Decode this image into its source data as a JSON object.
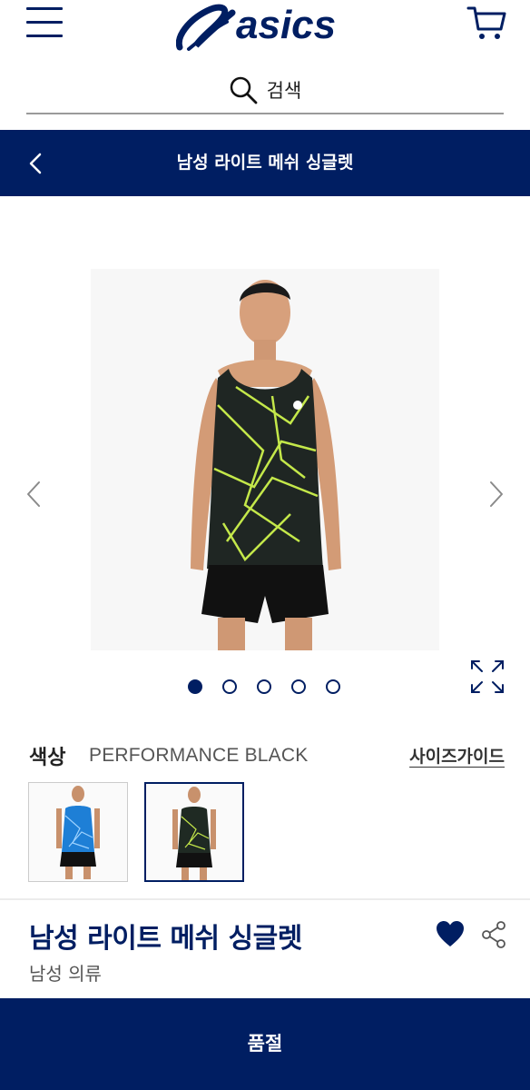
{
  "header": {
    "brand": "asics",
    "search_placeholder": "검색"
  },
  "titlebar": {
    "title": "남성 라이트 메쉬 싱글렛"
  },
  "gallery": {
    "slide_count": 5,
    "active_slide": 1
  },
  "product": {
    "color_label": "색상",
    "color_name": "PERFORMANCE BLACK",
    "size_guide": "사이즈가이드",
    "swatches": [
      {
        "color": "#1e7fd6",
        "pattern": "#9fd3ff"
      },
      {
        "color": "#1f2a23",
        "pattern": "#c4e84a"
      }
    ],
    "title": "남성 라이트 메쉬 싱글렛",
    "category": "남성 의류",
    "wishlisted": true
  },
  "footer": {
    "button_label": "품절"
  },
  "colors": {
    "brand_navy": "#001e62"
  },
  "icons": [
    "menu-icon",
    "brand-logo",
    "cart-icon",
    "search-icon",
    "back-chevron-icon",
    "prev-chevron-icon",
    "next-chevron-icon",
    "expand-icon",
    "heart-icon",
    "share-icon"
  ]
}
